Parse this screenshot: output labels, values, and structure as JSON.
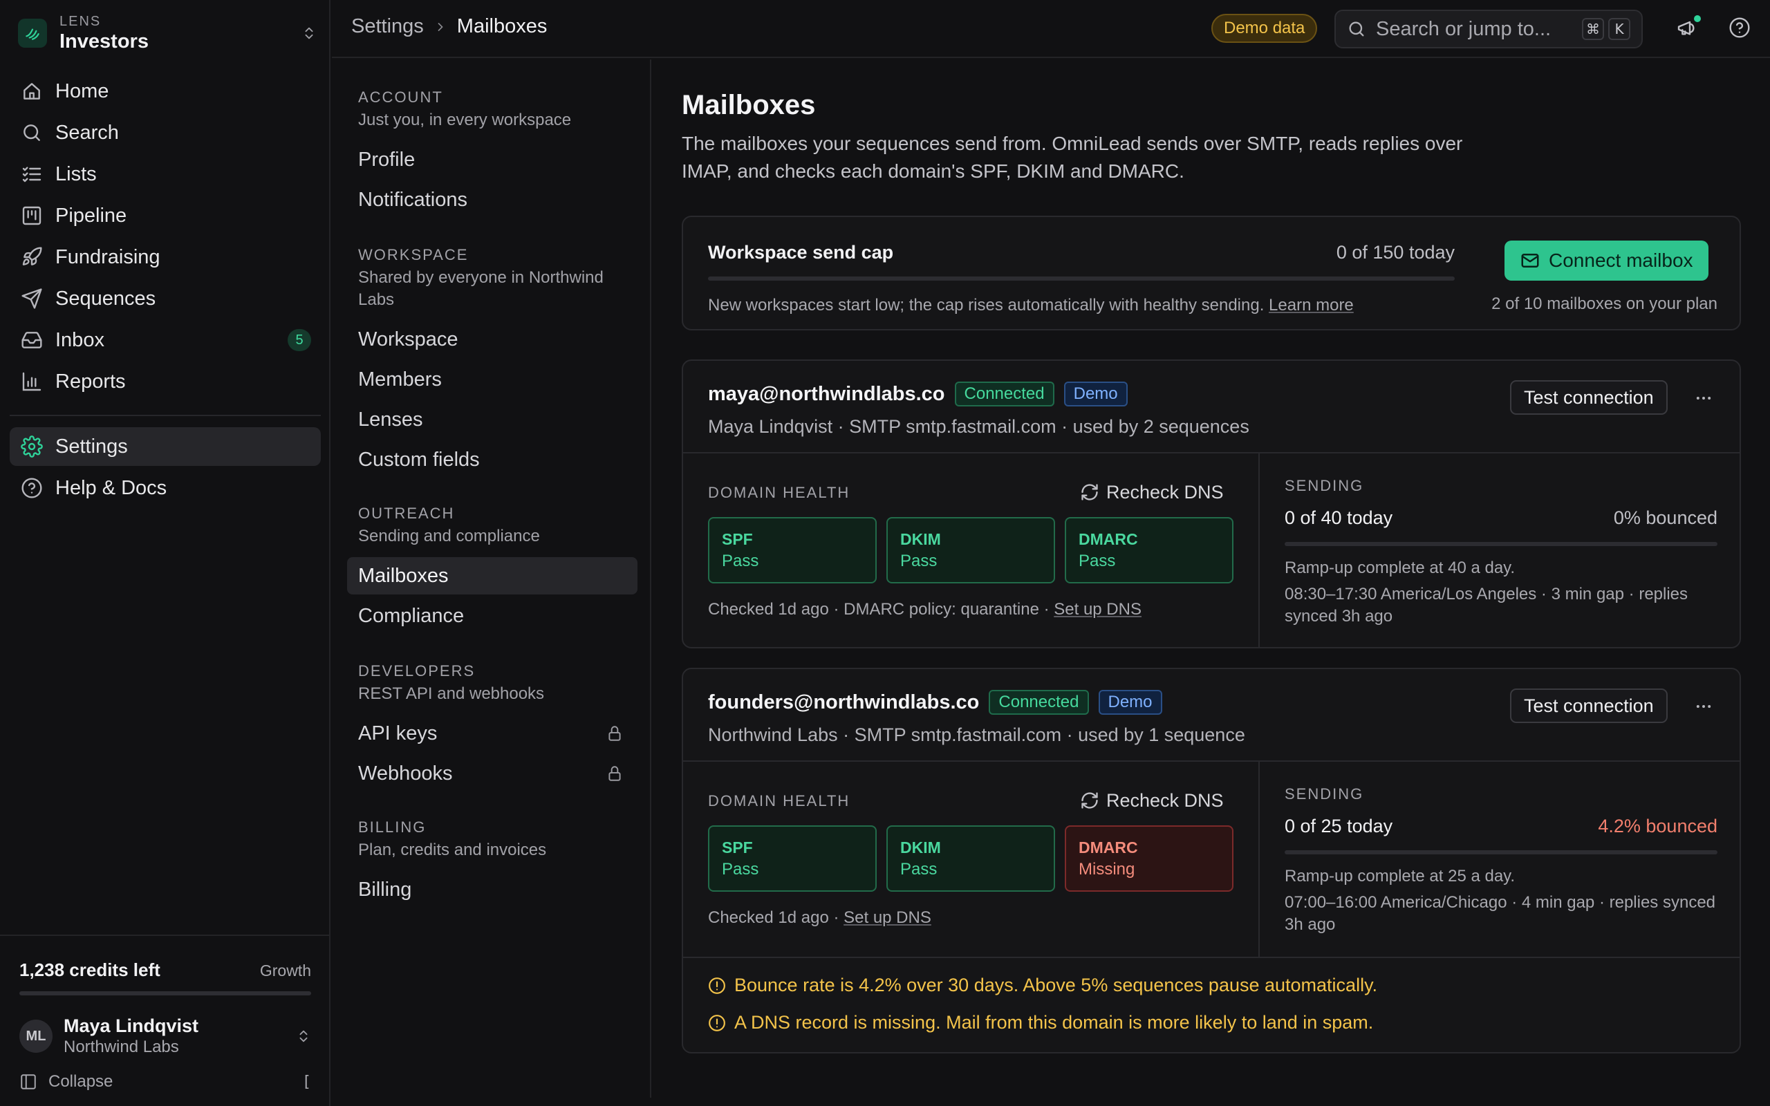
{
  "workspace": {
    "eyebrow": "LENS",
    "name": "Investors"
  },
  "nav": {
    "items": [
      {
        "label": "Home",
        "icon": "home-icon"
      },
      {
        "label": "Search",
        "icon": "search-icon"
      },
      {
        "label": "Lists",
        "icon": "list-icon"
      },
      {
        "label": "Pipeline",
        "icon": "kanban-icon"
      },
      {
        "label": "Fundraising",
        "icon": "rocket-icon"
      },
      {
        "label": "Sequences",
        "icon": "send-icon"
      },
      {
        "label": "Inbox",
        "icon": "inbox-icon",
        "badge": "5"
      },
      {
        "label": "Reports",
        "icon": "bar-chart-icon"
      }
    ],
    "secondary": [
      {
        "label": "Settings",
        "icon": "gear-icon",
        "active": true
      },
      {
        "label": "Help & Docs",
        "icon": "help-circle-icon"
      }
    ]
  },
  "credits": {
    "left": "1,238 credits left",
    "plan": "Growth",
    "used_fraction": 0.0
  },
  "user": {
    "initials": "ML",
    "name": "Maya Lindqvist",
    "org": "Northwind Labs"
  },
  "collapse": {
    "label": "Collapse",
    "shortcut": "["
  },
  "topbar": {
    "breadcrumb": [
      "Settings",
      "Mailboxes"
    ],
    "demo_label": "Demo data",
    "search_placeholder": "Search or jump to...",
    "shortcut_keys": [
      "⌘",
      "K"
    ]
  },
  "settings_nav": {
    "account": {
      "title": "ACCOUNT",
      "sub": "Just you, in every workspace",
      "items": [
        "Profile",
        "Notifications"
      ]
    },
    "workspace": {
      "title": "WORKSPACE",
      "sub": "Shared by everyone in Northwind Labs",
      "items": [
        "Workspace",
        "Members",
        "Lenses",
        "Custom fields"
      ]
    },
    "outreach": {
      "title": "OUTREACH",
      "sub": "Sending and compliance",
      "items": [
        "Mailboxes",
        "Compliance"
      ]
    },
    "developers": {
      "title": "DEVELOPERS",
      "sub": "REST API and webhooks",
      "items": [
        "API keys",
        "Webhooks"
      ]
    },
    "billing": {
      "title": "BILLING",
      "sub": "Plan, credits and invoices",
      "items": [
        "Billing"
      ]
    }
  },
  "page": {
    "title": "Mailboxes",
    "description": "The mailboxes your sequences send from. OmniLead sends over SMTP, reads replies over IMAP, and checks each domain's SPF, DKIM and DMARC."
  },
  "send_cap": {
    "title": "Workspace send cap",
    "count": "0 of 150 today",
    "used_fraction": 0.0,
    "note": "New workspaces start low; the cap rises automatically with healthy sending.",
    "note_link": "Learn more",
    "connect_label": "Connect mailbox",
    "plan_note": "2 of 10 mailboxes on your plan"
  },
  "mailboxes": [
    {
      "email": "maya@northwindlabs.co",
      "status": "Connected",
      "tag": "Demo",
      "sub": "Maya Lindqvist · SMTP smtp.fastmail.com · used by 2 sequences",
      "test_label": "Test connection",
      "domain_health_title": "DOMAIN HEALTH",
      "recheck_label": "Recheck DNS",
      "dns": [
        {
          "name": "SPF",
          "status": "Pass"
        },
        {
          "name": "DKIM",
          "status": "Pass"
        },
        {
          "name": "DMARC",
          "status": "Pass"
        }
      ],
      "checked": "Checked 1d ago · DMARC policy: quarantine · ",
      "checked_link": "Set up DNS",
      "sending_title": "SENDING",
      "send_count": "0 of 40 today",
      "bounce": "0% bounced",
      "send_fraction": 0.0,
      "ramp": "Ramp-up complete at 40 a day.",
      "schedule": "08:30–17:30 America/Los Angeles · 3 min gap · replies synced 3h ago"
    },
    {
      "email": "founders@northwindlabs.co",
      "status": "Connected",
      "tag": "Demo",
      "sub": "Northwind Labs · SMTP smtp.fastmail.com · used by 1 sequence",
      "test_label": "Test connection",
      "domain_health_title": "DOMAIN HEALTH",
      "recheck_label": "Recheck DNS",
      "dns": [
        {
          "name": "SPF",
          "status": "Pass"
        },
        {
          "name": "DKIM",
          "status": "Pass"
        },
        {
          "name": "DMARC",
          "status": "Missing"
        }
      ],
      "checked": "Checked 1d ago · ",
      "checked_link": "Set up DNS",
      "sending_title": "SENDING",
      "send_count": "0 of 25 today",
      "bounce": "4.2% bounced",
      "send_fraction": 0.0,
      "ramp": "Ramp-up complete at 25 a day.",
      "schedule": "07:00–16:00 America/Chicago · 4 min gap · replies synced 3h ago",
      "alerts": [
        "Bounce rate is 4.2% over 30 days. Above 5% sequences pause automatically.",
        "A DNS record is missing. Mail from this domain is more likely to land in spam."
      ]
    }
  ],
  "colors": {
    "accent": "#2ec48e",
    "warning": "#f3c34a",
    "danger": "#f27f6d",
    "background": "#111113"
  }
}
